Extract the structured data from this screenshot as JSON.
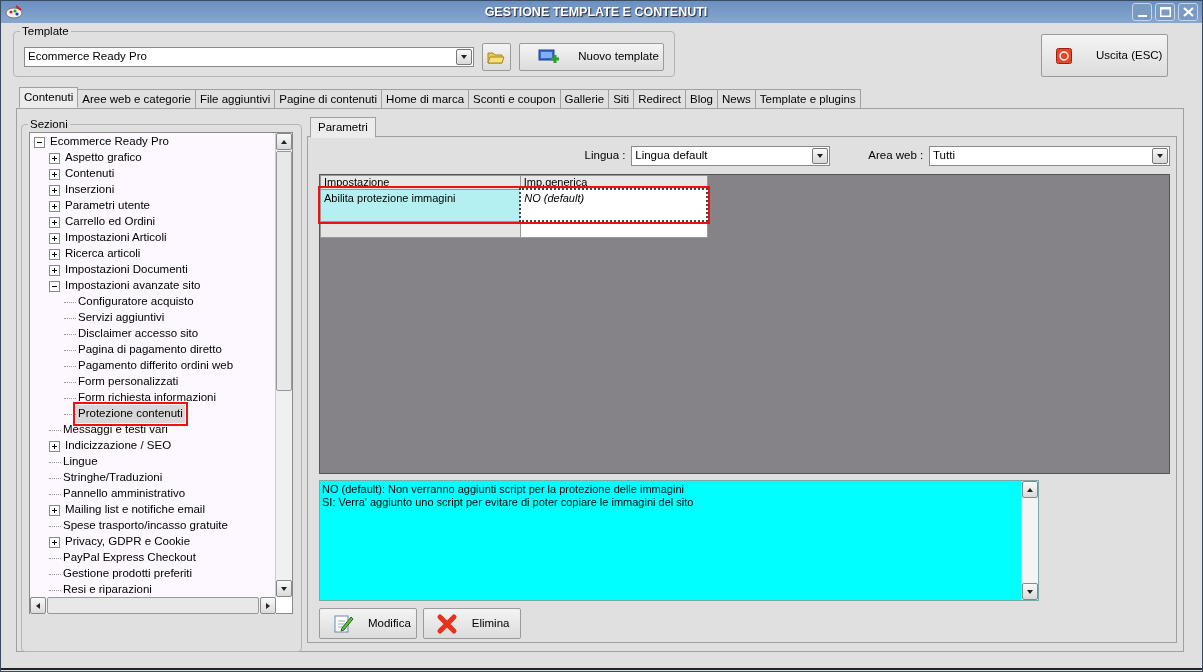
{
  "window": {
    "title": "GESTIONE TEMPLATE E CONTENUTI"
  },
  "template": {
    "label": "Template",
    "value": "Ecommerce Ready Pro",
    "new_button": "Nuovo template"
  },
  "exit_button": "Uscita (ESC)",
  "tabs": [
    {
      "label": "Contenuti",
      "selected": true
    },
    {
      "label": "Aree web e categorie",
      "selected": false
    },
    {
      "label": "File aggiuntivi",
      "selected": false
    },
    {
      "label": "Pagine di contenuti",
      "selected": false
    },
    {
      "label": "Home di marca",
      "selected": false
    },
    {
      "label": "Sconti e coupon",
      "selected": false
    },
    {
      "label": "Gallerie",
      "selected": false
    },
    {
      "label": "Siti",
      "selected": false
    },
    {
      "label": "Redirect",
      "selected": false
    },
    {
      "label": "Blog",
      "selected": false
    },
    {
      "label": "News",
      "selected": false
    },
    {
      "label": "Template e plugins",
      "selected": false
    }
  ],
  "sections": {
    "label": "Sezioni",
    "tree": [
      {
        "label": "Ecommerce Ready Pro",
        "expanded": true,
        "selected": false,
        "highlighted": false,
        "children": [
          {
            "label": "Aspetto grafico",
            "expanded": false,
            "selected": false,
            "highlighted": false
          },
          {
            "label": "Contenuti",
            "expanded": false,
            "selected": false,
            "highlighted": false
          },
          {
            "label": "Inserzioni",
            "expanded": false,
            "selected": false,
            "highlighted": false
          },
          {
            "label": "Parametri utente",
            "expanded": false,
            "selected": false,
            "highlighted": false
          },
          {
            "label": "Carrello ed Ordini",
            "expanded": false,
            "selected": false,
            "highlighted": false
          },
          {
            "label": "Impostazioni Articoli",
            "expanded": false,
            "selected": false,
            "highlighted": false
          },
          {
            "label": "Ricerca articoli",
            "expanded": false,
            "selected": false,
            "highlighted": false
          },
          {
            "label": "Impostazioni Documenti",
            "expanded": false,
            "selected": false,
            "highlighted": false
          },
          {
            "label": "Impostazioni avanzate sito",
            "expanded": true,
            "selected": false,
            "highlighted": false,
            "children": [
              {
                "label": "Configuratore acquisto",
                "selected": false,
                "highlighted": false
              },
              {
                "label": "Servizi aggiuntivi",
                "selected": false,
                "highlighted": false
              },
              {
                "label": "Disclaimer accesso sito",
                "selected": false,
                "highlighted": false
              },
              {
                "label": "Pagina di pagamento diretto",
                "selected": false,
                "highlighted": false
              },
              {
                "label": "Pagamento differito ordini web",
                "selected": false,
                "highlighted": false
              },
              {
                "label": "Form personalizzati",
                "selected": false,
                "highlighted": false
              },
              {
                "label": "Form richiesta informazioni",
                "selected": false,
                "highlighted": false
              },
              {
                "label": "Protezione contenuti",
                "selected": true,
                "highlighted": true
              }
            ]
          },
          {
            "label": "Messaggi e testi vari",
            "selected": false,
            "highlighted": false
          },
          {
            "label": "Indicizzazione / SEO",
            "expanded": false,
            "selected": false,
            "highlighted": false
          },
          {
            "label": "Lingue",
            "selected": false,
            "highlighted": false
          },
          {
            "label": "Stringhe/Traduzioni",
            "selected": false,
            "highlighted": false
          },
          {
            "label": "Pannello amministrativo",
            "selected": false,
            "highlighted": false
          },
          {
            "label": "Mailing list e notifiche email",
            "expanded": false,
            "selected": false,
            "highlighted": false
          },
          {
            "label": "Spese trasporto/incasso gratuite",
            "selected": false,
            "highlighted": false
          },
          {
            "label": "Privacy, GDPR e Cookie",
            "expanded": false,
            "selected": false,
            "highlighted": false
          },
          {
            "label": "PayPal Express Checkout",
            "selected": false,
            "highlighted": false
          },
          {
            "label": "Gestione prodotti preferiti",
            "selected": false,
            "highlighted": false
          },
          {
            "label": "Resi e riparazioni",
            "selected": false,
            "highlighted": false
          }
        ]
      }
    ]
  },
  "subtabs": [
    {
      "label": "Parametri",
      "selected": true
    }
  ],
  "filters": [
    {
      "label": "Lingua :",
      "value": "Lingua default"
    },
    {
      "label": "Area web :",
      "value": "Tutti"
    }
  ],
  "table": {
    "columns": [
      "Impostazione",
      "Imp.generica"
    ],
    "rows": [
      {
        "cells": [
          "Abilita protezione immagini",
          "NO (default)"
        ],
        "selected": true,
        "highlighted": true
      }
    ]
  },
  "description": [
    "NO (default): Non verranno aggiunti script per la protezione delle immagini",
    "SI: Verra' aggiunto uno script per evitare di poter copiare le immagini del sito"
  ],
  "actions": [
    {
      "kind": "edit",
      "label": "Modifica"
    },
    {
      "kind": "delete",
      "label": "Elimina"
    }
  ]
}
